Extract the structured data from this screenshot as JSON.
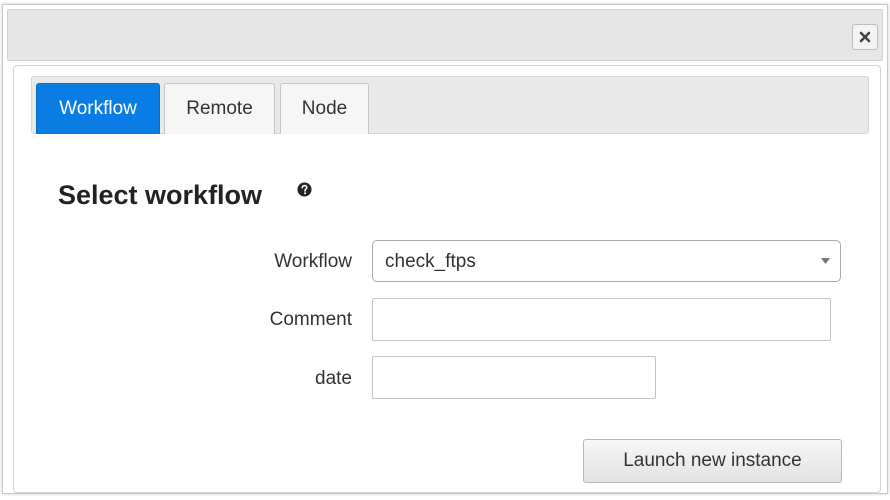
{
  "dialog": {
    "close_icon": "close-x-icon"
  },
  "tabs": [
    {
      "label": "Workflow",
      "active": true
    },
    {
      "label": "Remote",
      "active": false
    },
    {
      "label": "Node",
      "active": false
    }
  ],
  "section": {
    "title": "Select workflow",
    "help_icon": "question-circle-icon"
  },
  "form": {
    "workflow": {
      "label": "Workflow",
      "value": "check_ftps"
    },
    "comment": {
      "label": "Comment",
      "value": "",
      "placeholder": ""
    },
    "date": {
      "label": "date",
      "value": "",
      "placeholder": ""
    }
  },
  "actions": {
    "launch_label": "Launch new instance"
  },
  "colors": {
    "active_tab": "#0a7de4",
    "titlebar": "#e6e6e6"
  }
}
